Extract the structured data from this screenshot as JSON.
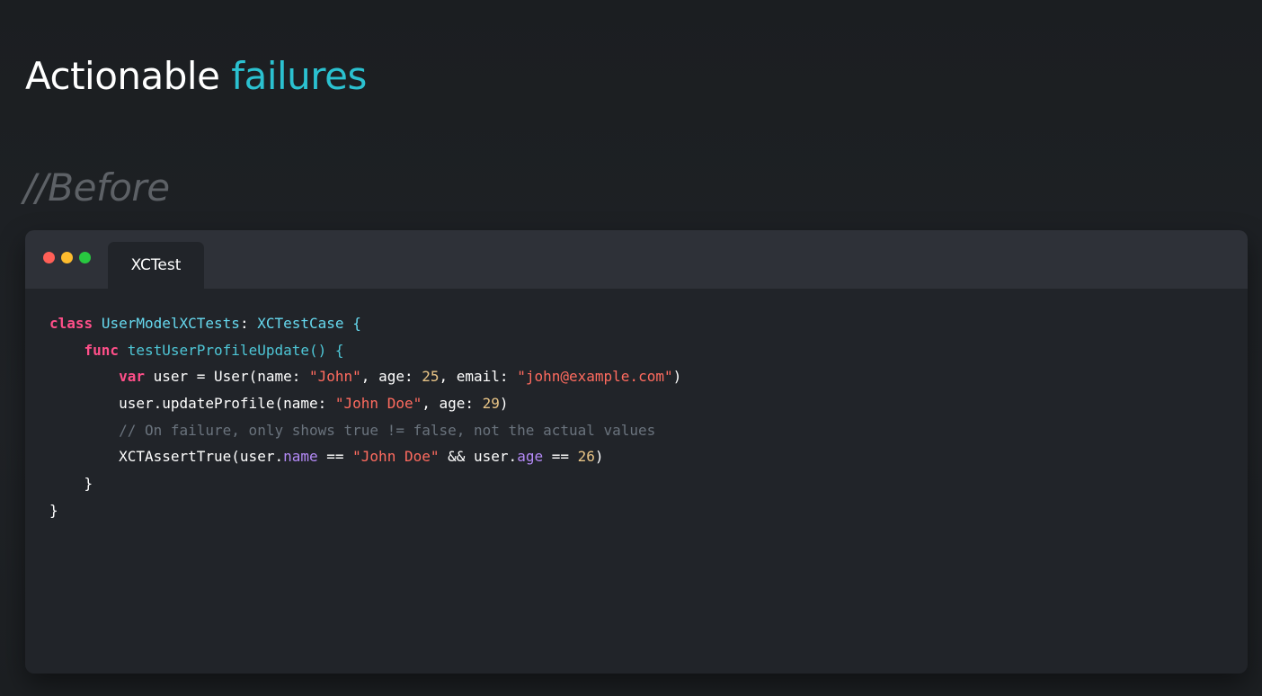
{
  "slide": {
    "title_prefix": "Actionable ",
    "title_highlight": "failures",
    "section_label": "//Before"
  },
  "colors": {
    "background": "#1e2124",
    "accent": "#2bc1d0",
    "section_label": "#5d6166",
    "editor_bg": "#212429",
    "titlebar_bg": "#2e3138",
    "keyword": "#ff4f89",
    "type": "#66d9ef",
    "string": "#ff6b5f",
    "number": "#e8c486",
    "property": "#b48af7",
    "comment": "#6a737d"
  },
  "window": {
    "controls": [
      "close",
      "minimize",
      "zoom"
    ],
    "tab_label": "XCTest"
  },
  "code": {
    "l1": {
      "kw": "class",
      "name": "UserModelXCTests",
      "colon": ":",
      "parent": "XCTestCase",
      "brace": "{"
    },
    "l2": {
      "kw": "func",
      "sig": "testUserProfileUpdate() {"
    },
    "l3": {
      "kw": "var",
      "p1": "user = User(name: ",
      "s1": "\"John\"",
      "p2": ", age: ",
      "n1": "25",
      "p3": ", email: ",
      "s2": "\"john@example.com\"",
      "p4": ")"
    },
    "l4": {
      "p1": "user.updateProfile(name: ",
      "s1": "\"John Doe\"",
      "p2": ", age: ",
      "n1": "29",
      "p3": ")"
    },
    "l5": {
      "comment": "// On failure, only shows true != false, not the actual values"
    },
    "l6": {
      "p1": "XCTAssertTrue(user.",
      "prop1": "name",
      "p2": " == ",
      "s1": "\"John Doe\"",
      "p3": " && user.",
      "prop2": "age",
      "p4": " == ",
      "n1": "26",
      "p5": ")"
    },
    "l7": {
      "brace": "}"
    },
    "l8": {
      "brace": "}"
    }
  }
}
